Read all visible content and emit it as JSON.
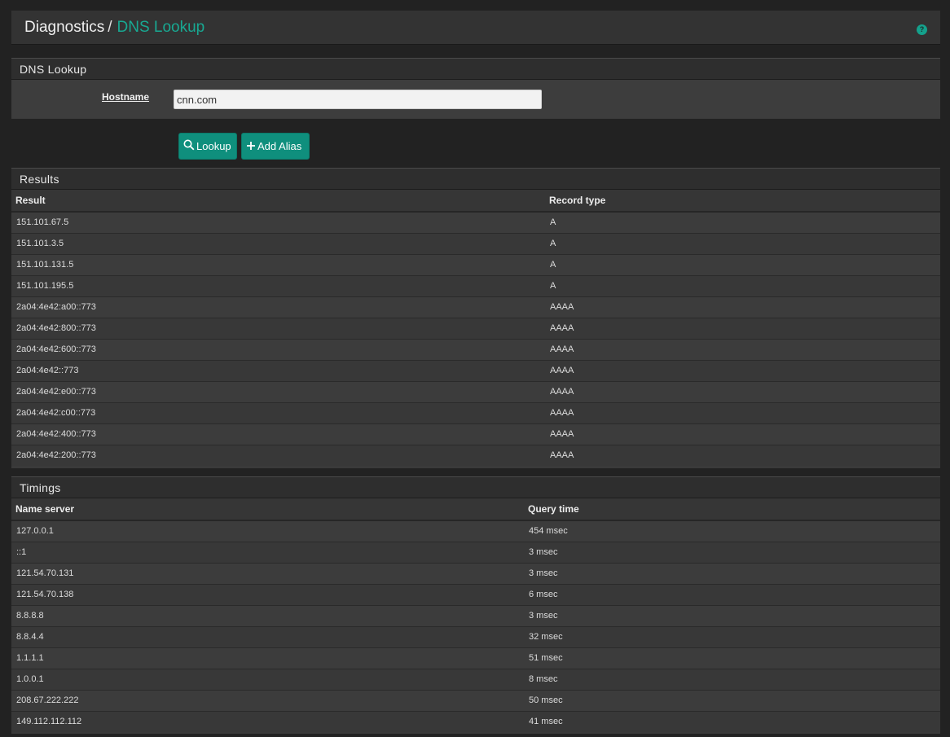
{
  "breadcrumb": {
    "parent": "Diagnostics",
    "separator": "/",
    "current": "DNS Lookup"
  },
  "help_icon": "help-icon",
  "lookup_panel": {
    "title": "DNS Lookup",
    "hostname_label": "Hostname",
    "hostname_value": "cnn.com"
  },
  "buttons": {
    "lookup": "Lookup",
    "add_alias": "Add Alias"
  },
  "results": {
    "title": "Results",
    "headers": {
      "result": "Result",
      "record_type": "Record type"
    },
    "rows": [
      {
        "result": "151.101.67.5",
        "type": "A"
      },
      {
        "result": "151.101.3.5",
        "type": "A"
      },
      {
        "result": "151.101.131.5",
        "type": "A"
      },
      {
        "result": "151.101.195.5",
        "type": "A"
      },
      {
        "result": "2a04:4e42:a00::773",
        "type": "AAAA"
      },
      {
        "result": "2a04:4e42:800::773",
        "type": "AAAA"
      },
      {
        "result": "2a04:4e42:600::773",
        "type": "AAAA"
      },
      {
        "result": "2a04:4e42::773",
        "type": "AAAA"
      },
      {
        "result": "2a04:4e42:e00::773",
        "type": "AAAA"
      },
      {
        "result": "2a04:4e42:c00::773",
        "type": "AAAA"
      },
      {
        "result": "2a04:4e42:400::773",
        "type": "AAAA"
      },
      {
        "result": "2a04:4e42:200::773",
        "type": "AAAA"
      }
    ]
  },
  "timings": {
    "title": "Timings",
    "headers": {
      "name_server": "Name server",
      "query_time": "Query time"
    },
    "rows": [
      {
        "server": "127.0.0.1",
        "time": "454 msec"
      },
      {
        "server": "::1",
        "time": "3 msec"
      },
      {
        "server": "121.54.70.131",
        "time": "3 msec"
      },
      {
        "server": "121.54.70.138",
        "time": "6 msec"
      },
      {
        "server": "8.8.8.8",
        "time": "3 msec"
      },
      {
        "server": "8.8.4.4",
        "time": "32 msec"
      },
      {
        "server": "1.1.1.1",
        "time": "51 msec"
      },
      {
        "server": "1.0.0.1",
        "time": "8 msec"
      },
      {
        "server": "208.67.222.222",
        "time": "50 msec"
      },
      {
        "server": "149.112.112.112",
        "time": "41 msec"
      }
    ]
  },
  "colors": {
    "accent": "#18a892",
    "button": "#0f8f7d"
  }
}
